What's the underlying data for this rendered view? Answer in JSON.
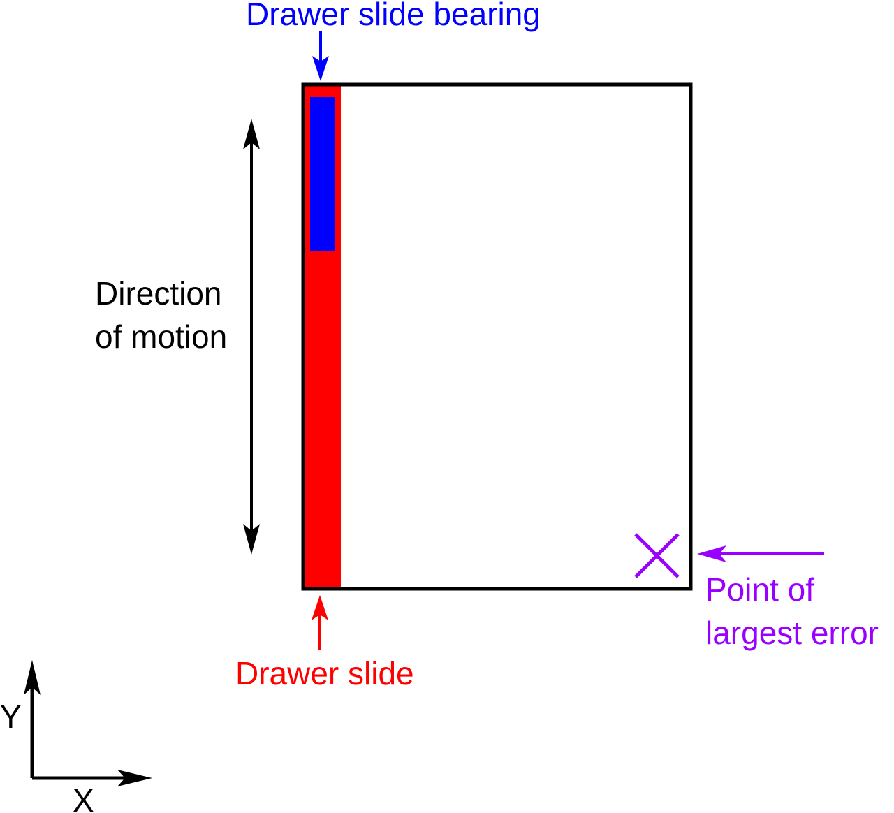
{
  "labels": {
    "bearing": "Drawer slide bearing",
    "direction_line1": "Direction",
    "direction_line2": "of motion",
    "slide": "Drawer slide",
    "error_line1": "Point of",
    "error_line2": "largest error",
    "axis_y": "Y",
    "axis_x": "X"
  },
  "colors": {
    "slide": "#ff0000",
    "bearing": "#0000ff",
    "error": "#9900ff",
    "outline": "#000000"
  }
}
